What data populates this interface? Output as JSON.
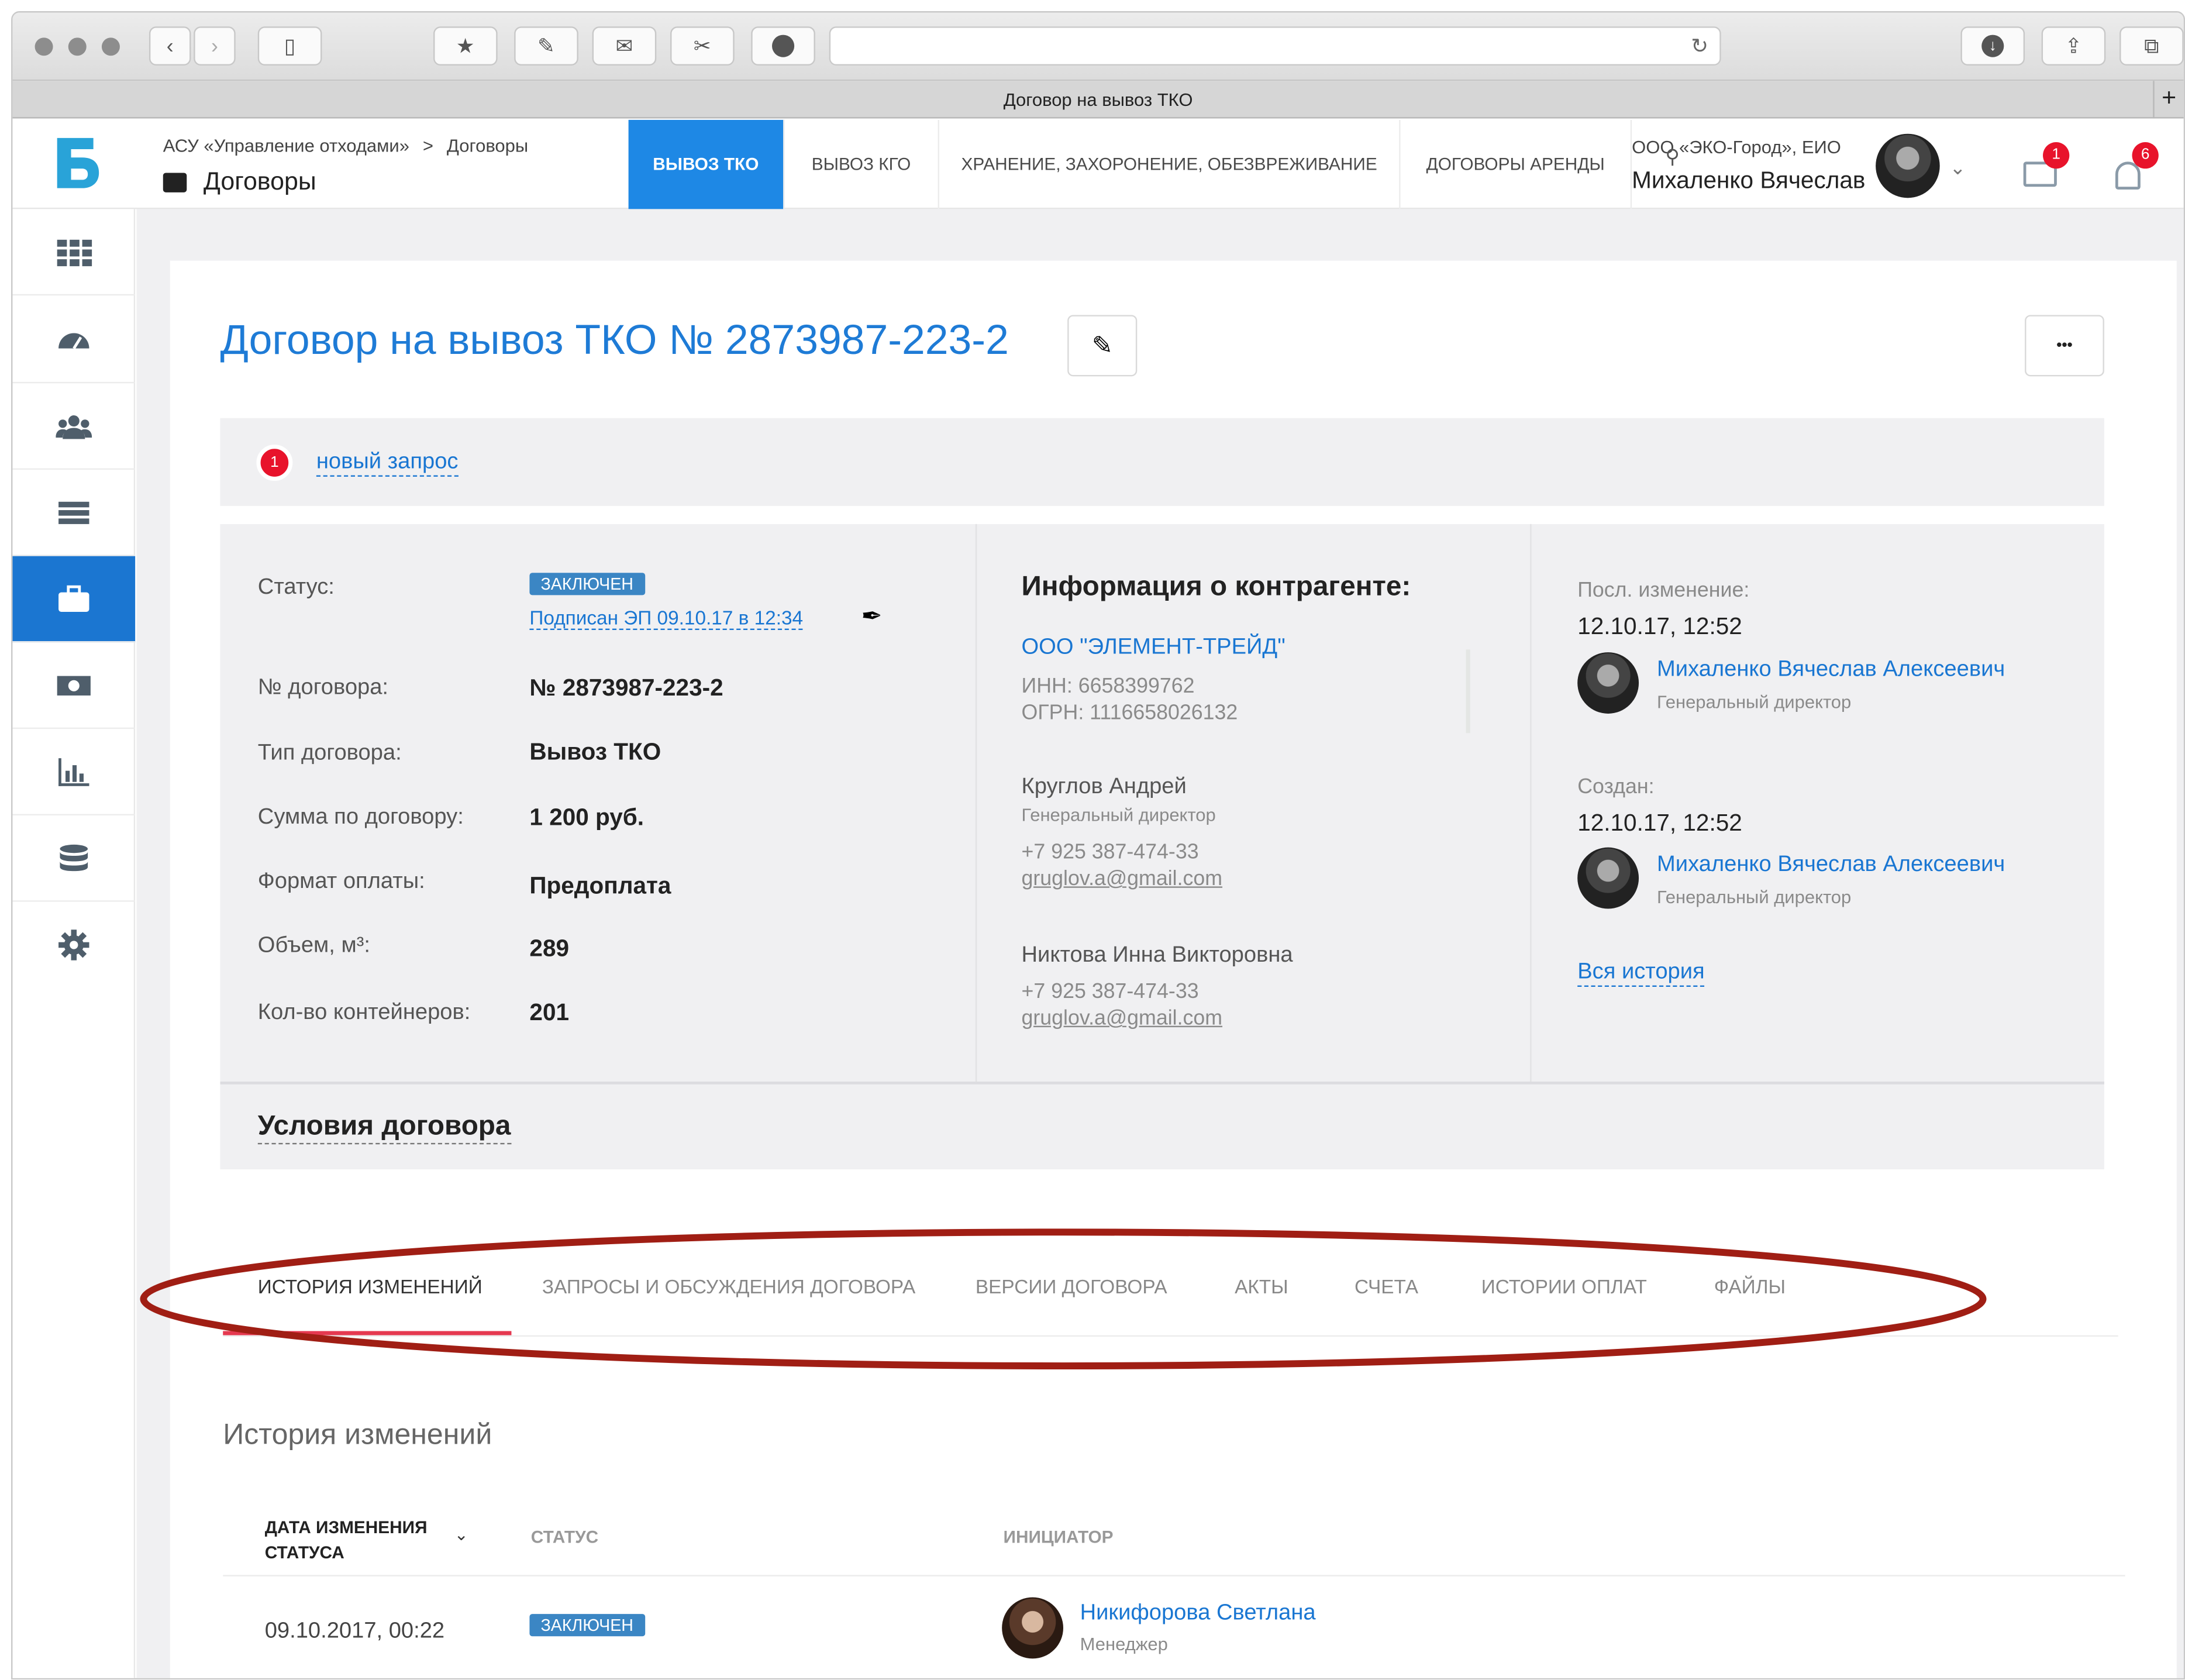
{
  "browser": {
    "tab_title": "Договор на вывоз ТКО"
  },
  "header": {
    "breadcrumb": [
      "АСУ «Управление отходами»",
      "Договоры"
    ],
    "breadcrumb_sep": ">",
    "section_title": "Договоры",
    "nav_tabs": [
      {
        "label": "ВЫВОЗ ТКО",
        "active": true
      },
      {
        "label": "ВЫВОЗ КГО",
        "active": false
      },
      {
        "label": "ХРАНЕНИЕ, ЗАХОРОНЕНИЕ, ОБЕЗВРЕЖИВАНИЕ",
        "active": false
      },
      {
        "label": "ДОГОВОРЫ АРЕНДЫ",
        "active": false
      }
    ],
    "org": "ООО «ЭКО-Город», ЕИО",
    "user_name": "Михаленко Вячеслав",
    "mail_count": "1",
    "notif_count": "6"
  },
  "sidebar_icons": [
    "grid-icon",
    "dashboard-icon",
    "users-icon",
    "list-icon",
    "briefcase-icon",
    "money-icon",
    "chart-icon",
    "database-icon",
    "gear-icon"
  ],
  "page": {
    "title": "Договор на вывоз ТКО № 2873987-223-2",
    "more_label": "•••",
    "request_count": "1",
    "request_link": "новый запрос"
  },
  "details": {
    "status_label": "Статус:",
    "status_badge": "ЗАКЛЮЧЕН",
    "signed_link": "Подписан ЭП  09.10.17 в 12:34",
    "rows": [
      {
        "label": "№ договора:",
        "value": "№ 2873987-223-2"
      },
      {
        "label": "Тип договора:",
        "value": "Вывоз ТКО"
      },
      {
        "label": "Сумма по договору:",
        "value": "1 200 руб."
      },
      {
        "label": "Формат оплаты:",
        "value": "Предоплата"
      },
      {
        "label": "Объем, м³:",
        "value": "289"
      },
      {
        "label": "Кол-во контейнеров:",
        "value": "201"
      }
    ]
  },
  "counterparty": {
    "heading": "Информация о контрагенте:",
    "company": "ООО \"ЭЛЕМЕНТ-ТРЕЙД\"",
    "inn": "ИНН: 6658399762",
    "ogrn": "ОГРН: 1116658026132",
    "contacts": [
      {
        "name": "Круглов Андрей",
        "role": "Генеральный директор",
        "phone": "+7 925 387-474-33",
        "email": "gruglov.a@gmail.com"
      },
      {
        "name": "Никтова Инна Викторовна",
        "role": "",
        "phone": "+7 925 387-474-33",
        "email": "gruglov.a@gmail.com"
      }
    ]
  },
  "history_side": {
    "last_change_label": "Посл. изменение:",
    "last_change_date": "12.10.17, 12:52",
    "last_change_user": "Михаленко Вячеслав Алексеевич",
    "last_change_role": "Генеральный директор",
    "created_label": "Создан:",
    "created_date": "12.10.17, 12:52",
    "created_user": "Михаленко Вячеслав Алексеевич",
    "created_role": "Генеральный директор",
    "all_history": "Вся история"
  },
  "conditions_title": "Условия договора",
  "bottom_tabs": [
    "ИСТОРИЯ ИЗМЕНЕНИЙ",
    "ЗАПРОСЫ И ОБСУЖДЕНИЯ ДОГОВОРА",
    "ВЕРСИИ ДОГОВОРА",
    "АКТЫ",
    "СЧЕТА",
    "ИСТОРИИ ОПЛАТ",
    "ФАЙЛЫ"
  ],
  "history_table": {
    "title": "История изменений",
    "col_date_1": "ДАТА ИЗМЕНЕНИЯ",
    "col_date_2": "СТАТУСА",
    "col_status": "СТАТУС",
    "col_initiator": "ИНИЦИАТОР",
    "rows": [
      {
        "date": "09.10.2017, 00:22",
        "status": "ЗАКЛЮЧЕН",
        "name": "Никифорова Светлана",
        "role": "Менеджер"
      }
    ]
  },
  "colors": {
    "accent": "#1e88e5",
    "highlight_ellipse": "#a01e14",
    "badge": "#3b86c4",
    "red_badge": "#e8132b"
  }
}
